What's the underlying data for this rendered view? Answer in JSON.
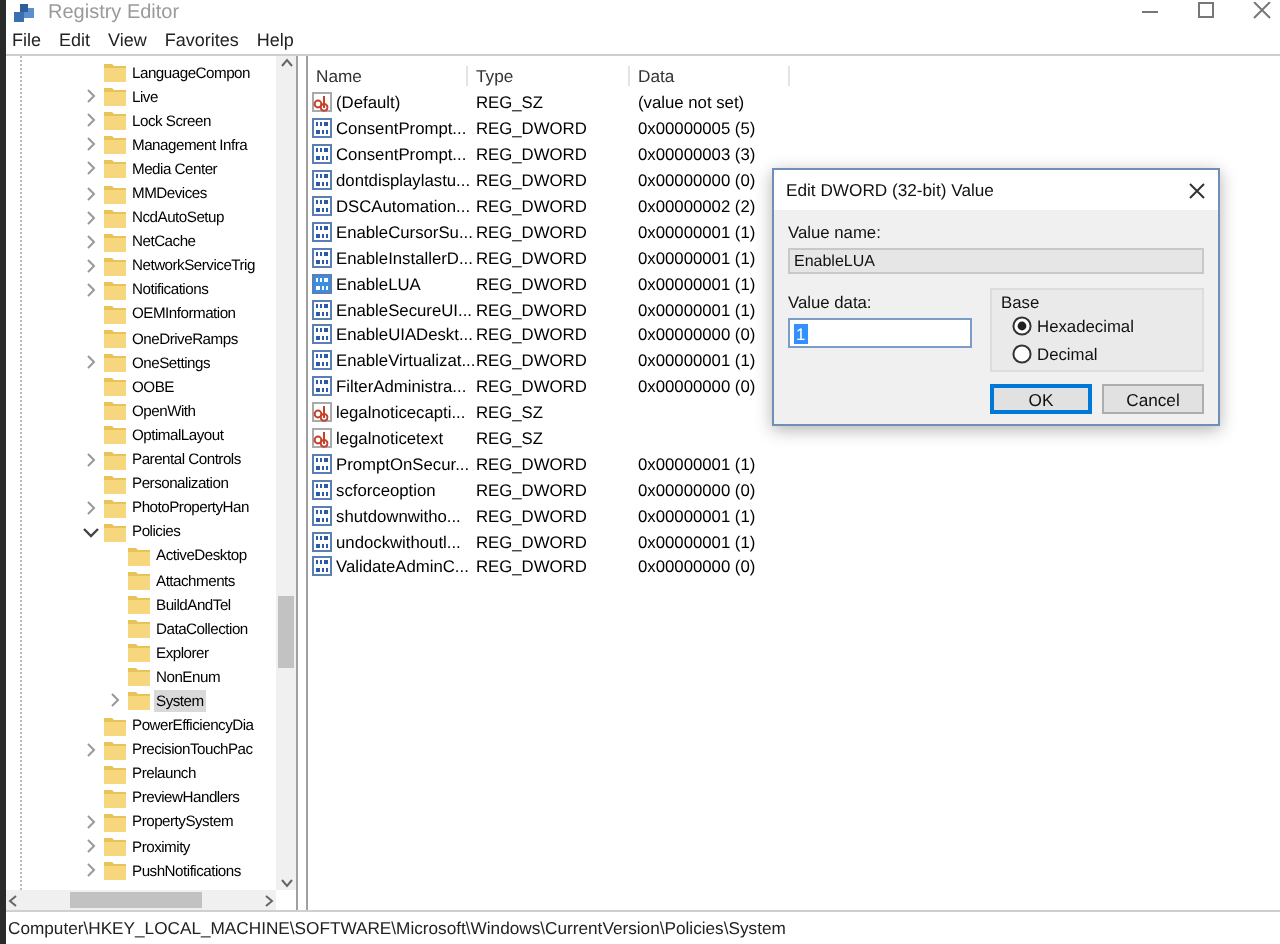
{
  "window": {
    "title": "Registry Editor"
  },
  "menu": [
    "File",
    "Edit",
    "View",
    "Favorites",
    "Help"
  ],
  "tree": [
    {
      "kind": "leaf",
      "label": "LanguageCompon",
      "selected": false
    },
    {
      "kind": "branch",
      "label": "Live",
      "expanded": false,
      "selected": false
    },
    {
      "kind": "branch",
      "label": "Lock Screen",
      "expanded": false,
      "selected": false
    },
    {
      "kind": "branch",
      "label": "Management Infra",
      "expanded": false,
      "selected": false
    },
    {
      "kind": "branch",
      "label": "Media Center",
      "expanded": false,
      "selected": false
    },
    {
      "kind": "branch",
      "label": "MMDevices",
      "expanded": false,
      "selected": false
    },
    {
      "kind": "branch",
      "label": "NcdAutoSetup",
      "expanded": false,
      "selected": false
    },
    {
      "kind": "branch",
      "label": "NetCache",
      "expanded": false,
      "selected": false
    },
    {
      "kind": "branch",
      "label": "NetworkServiceTrig",
      "expanded": false,
      "selected": false
    },
    {
      "kind": "branch",
      "label": "Notifications",
      "expanded": false,
      "selected": false
    },
    {
      "kind": "leaf",
      "label": "OEMInformation",
      "selected": false
    },
    {
      "kind": "leaf",
      "label": "OneDriveRamps",
      "selected": false
    },
    {
      "kind": "branch",
      "label": "OneSettings",
      "expanded": false,
      "selected": false
    },
    {
      "kind": "leaf",
      "label": "OOBE",
      "selected": false
    },
    {
      "kind": "leaf",
      "label": "OpenWith",
      "selected": false
    },
    {
      "kind": "leaf",
      "label": "OptimalLayout",
      "selected": false
    },
    {
      "kind": "branch",
      "label": "Parental Controls",
      "expanded": false,
      "selected": false
    },
    {
      "kind": "leaf",
      "label": "Personalization",
      "selected": false
    },
    {
      "kind": "branch",
      "label": "PhotoPropertyHan",
      "expanded": false,
      "selected": false
    },
    {
      "kind": "branch",
      "label": "Policies",
      "expanded": true,
      "selected": false,
      "children": [
        {
          "kind": "leaf",
          "label": "ActiveDesktop",
          "selected": false
        },
        {
          "kind": "leaf",
          "label": "Attachments",
          "selected": false
        },
        {
          "kind": "leaf",
          "label": "BuildAndTel",
          "selected": false
        },
        {
          "kind": "leaf",
          "label": "DataCollection",
          "selected": false
        },
        {
          "kind": "leaf",
          "label": "Explorer",
          "selected": false
        },
        {
          "kind": "leaf",
          "label": "NonEnum",
          "selected": false
        },
        {
          "kind": "branch",
          "label": "System",
          "expanded": false,
          "selected": true
        }
      ]
    },
    {
      "kind": "leaf",
      "label": "PowerEfficiencyDia",
      "selected": false
    },
    {
      "kind": "branch",
      "label": "PrecisionTouchPac",
      "expanded": false,
      "selected": false
    },
    {
      "kind": "leaf",
      "label": "Prelaunch",
      "selected": false
    },
    {
      "kind": "leaf",
      "label": "PreviewHandlers",
      "selected": false
    },
    {
      "kind": "branch",
      "label": "PropertySystem",
      "expanded": false,
      "selected": false
    },
    {
      "kind": "branch",
      "label": "Proximity",
      "expanded": false,
      "selected": false
    },
    {
      "kind": "branch",
      "label": "PushNotifications",
      "expanded": false,
      "selected": false
    }
  ],
  "values": {
    "columns": [
      "Name",
      "Type",
      "Data"
    ],
    "rows": [
      {
        "kind": "string",
        "name": "(Default)",
        "type": "REG_SZ",
        "data": "(value not set)",
        "selected": false
      },
      {
        "kind": "binary",
        "name": "ConsentPrompt...",
        "type": "REG_DWORD",
        "data": "0x00000005 (5)",
        "selected": false
      },
      {
        "kind": "binary",
        "name": "ConsentPrompt...",
        "type": "REG_DWORD",
        "data": "0x00000003 (3)",
        "selected": false
      },
      {
        "kind": "binary",
        "name": "dontdisplaylastu...",
        "type": "REG_DWORD",
        "data": "0x00000000 (0)",
        "selected": false
      },
      {
        "kind": "binary",
        "name": "DSCAutomation...",
        "type": "REG_DWORD",
        "data": "0x00000002 (2)",
        "selected": false
      },
      {
        "kind": "binary",
        "name": "EnableCursorSu...",
        "type": "REG_DWORD",
        "data": "0x00000001 (1)",
        "selected": false
      },
      {
        "kind": "binary",
        "name": "EnableInstallerD...",
        "type": "REG_DWORD",
        "data": "0x00000001 (1)",
        "selected": false
      },
      {
        "kind": "binary",
        "name": "EnableLUA",
        "type": "REG_DWORD",
        "data": "0x00000001 (1)",
        "selected": true
      },
      {
        "kind": "binary",
        "name": "EnableSecureUI...",
        "type": "REG_DWORD",
        "data": "0x00000001 (1)",
        "selected": false
      },
      {
        "kind": "binary",
        "name": "EnableUIADeskt...",
        "type": "REG_DWORD",
        "data": "0x00000000 (0)",
        "selected": false
      },
      {
        "kind": "binary",
        "name": "EnableVirtualizat...",
        "type": "REG_DWORD",
        "data": "0x00000001 (1)",
        "selected": false
      },
      {
        "kind": "binary",
        "name": "FilterAdministra...",
        "type": "REG_DWORD",
        "data": "0x00000000 (0)",
        "selected": false
      },
      {
        "kind": "string",
        "name": "legalnoticecapti...",
        "type": "REG_SZ",
        "selected": false
      },
      {
        "kind": "string",
        "name": "legalnoticetext",
        "type": "REG_SZ",
        "selected": false
      },
      {
        "kind": "binary",
        "name": "PromptOnSecur...",
        "type": "REG_DWORD",
        "data": "0x00000001 (1)",
        "selected": false
      },
      {
        "kind": "binary",
        "name": "scforceoption",
        "type": "REG_DWORD",
        "data": "0x00000000 (0)",
        "selected": false
      },
      {
        "kind": "binary",
        "name": "shutdownwitho...",
        "type": "REG_DWORD",
        "data": "0x00000001 (1)",
        "selected": false
      },
      {
        "kind": "binary",
        "name": "undockwithoutl...",
        "type": "REG_DWORD",
        "data": "0x00000001 (1)",
        "selected": false
      },
      {
        "kind": "binary",
        "name": "ValidateAdminC...",
        "type": "REG_DWORD",
        "data": "0x00000000 (0)",
        "selected": false
      }
    ]
  },
  "dialog": {
    "title": "Edit DWORD (32-bit) Value",
    "value_name_label": "Value name:",
    "value_name": "EnableLUA",
    "value_data_label": "Value data:",
    "value_data": "1",
    "base_label": "Base",
    "base_options": [
      {
        "label": "Hexadecimal",
        "selected": true
      },
      {
        "label": "Decimal",
        "selected": false
      }
    ],
    "buttons": [
      {
        "label": "OK",
        "default": true
      },
      {
        "label": "Cancel",
        "default": false
      }
    ]
  },
  "status_bar": "Computer\\HKEY_LOCAL_MACHINE\\SOFTWARE\\Microsoft\\Windows\\CurrentVersion\\Policies\\System"
}
